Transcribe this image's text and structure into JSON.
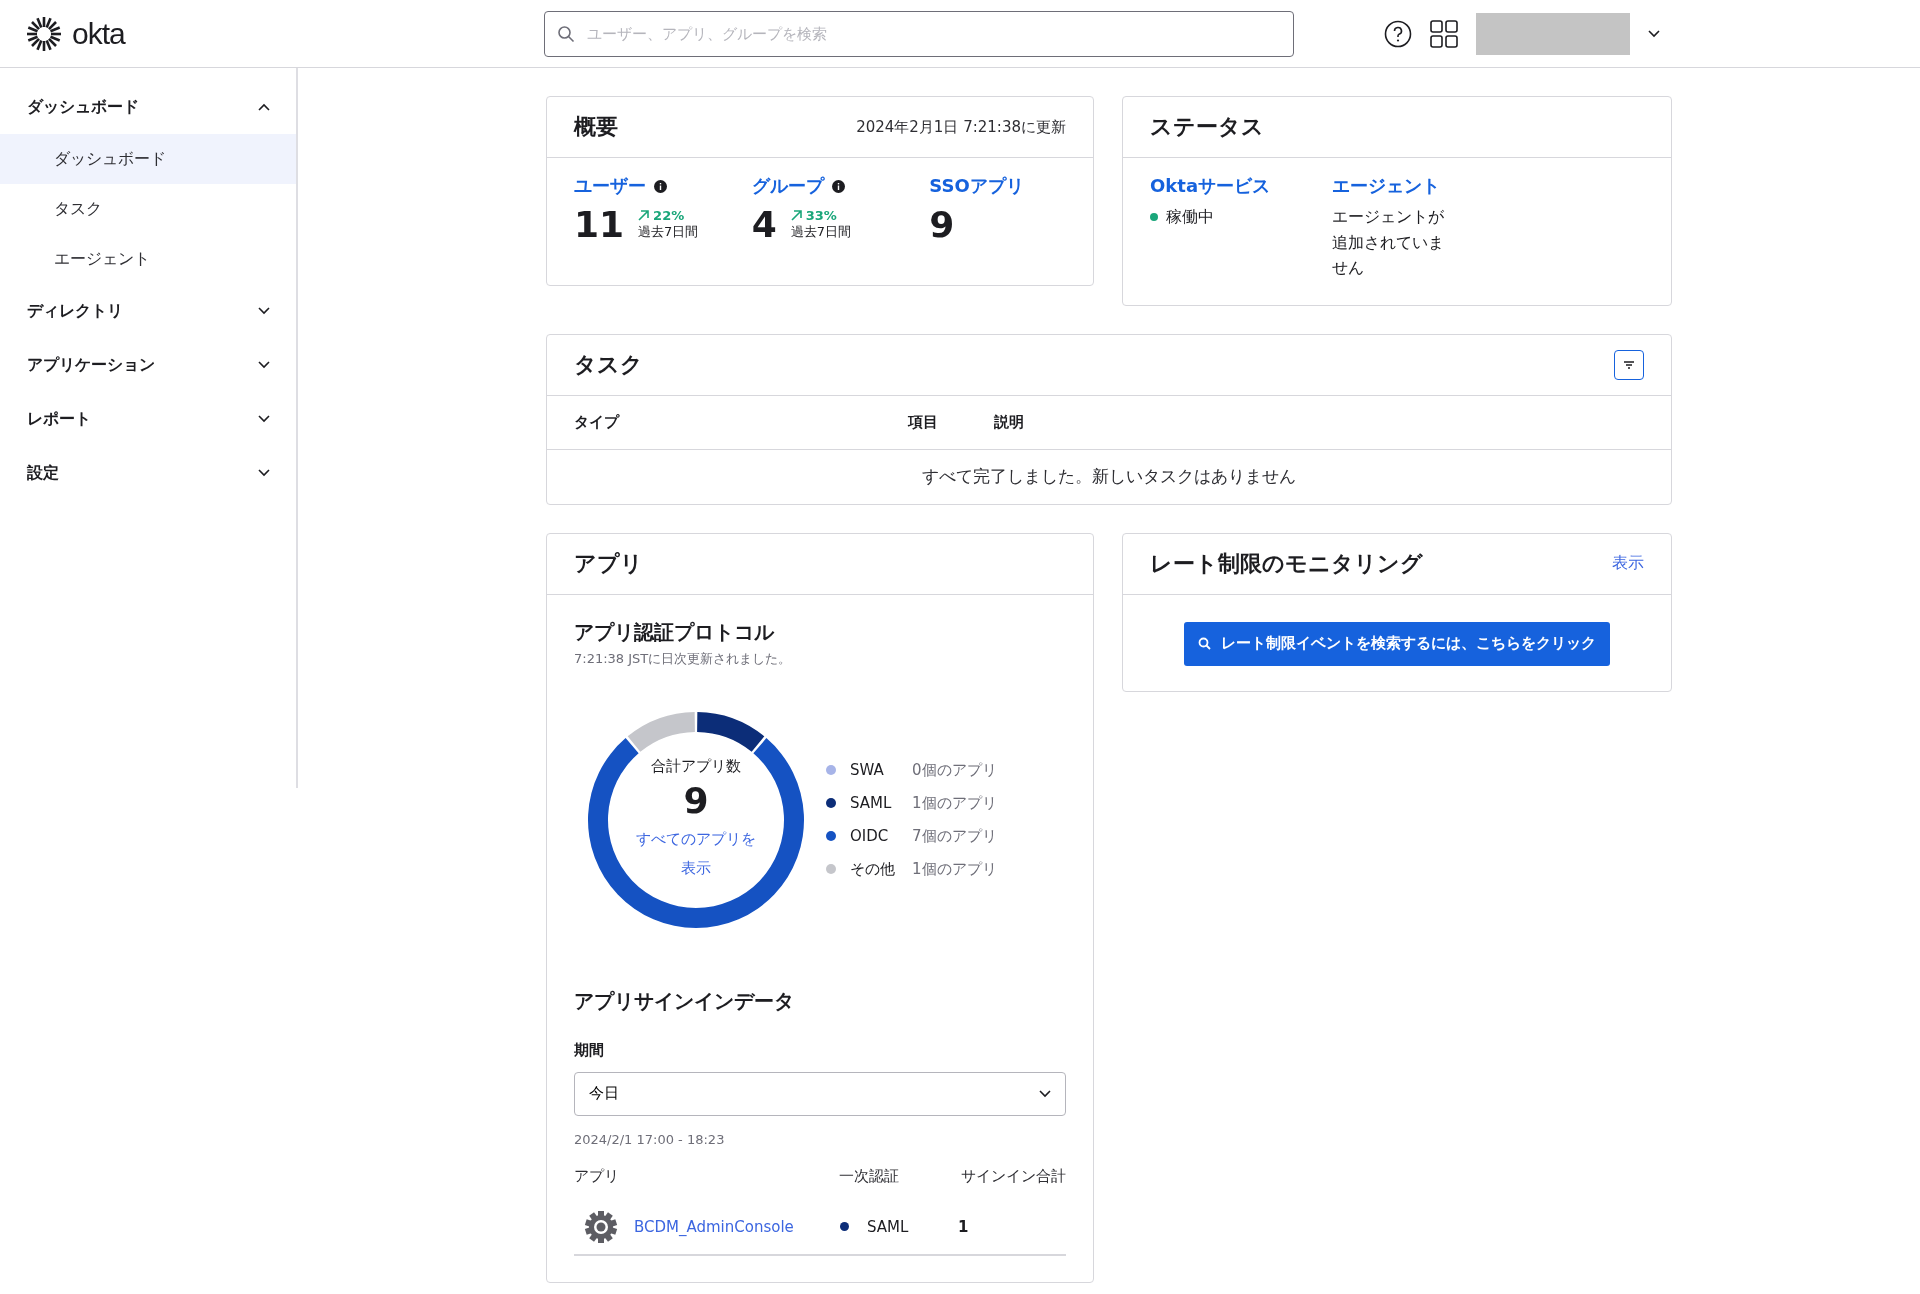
{
  "header": {
    "logo": "okta",
    "search": {
      "placeholder": "ユーザー、アプリ、グループを検索"
    }
  },
  "sidebar": {
    "items": [
      {
        "label": "ダッシュボード",
        "expanded": true,
        "children": [
          {
            "label": "ダッシュボード",
            "selected": true
          },
          {
            "label": "タスク",
            "selected": false
          },
          {
            "label": "エージェント",
            "selected": false
          }
        ]
      },
      {
        "label": "ディレクトリ",
        "expanded": false
      },
      {
        "label": "アプリケーション",
        "expanded": false
      },
      {
        "label": "レポート",
        "expanded": false
      },
      {
        "label": "設定",
        "expanded": false
      }
    ]
  },
  "overview": {
    "title": "概要",
    "updated": "2024年2月1日 7:21:38に更新",
    "stats": [
      {
        "label": "ユーザー",
        "info": true,
        "value": "11",
        "change": "22%",
        "period": "過去7日間"
      },
      {
        "label": "グループ",
        "info": true,
        "value": "4",
        "change": "33%",
        "period": "過去7日間"
      },
      {
        "label": "SSOアプリ",
        "info": false,
        "value": "9"
      }
    ]
  },
  "status": {
    "title": "ステータス",
    "columns": [
      {
        "label": "Oktaサービス",
        "kind": "dot",
        "text": "稼働中",
        "color": "#1aa67a"
      },
      {
        "label": "エージェント",
        "kind": "text",
        "text": "エージェントが追加されていません"
      }
    ]
  },
  "tasks": {
    "title": "タスク",
    "columns": [
      "タイプ",
      "項目",
      "説明"
    ],
    "empty": "すべて完了しました。新しいタスクはありません"
  },
  "apps": {
    "title": "アプリ",
    "protocol_title": "アプリ認証プロトコル",
    "protocol_note": "7:21:38 JSTに日次更新されました。",
    "center_label": "合計アプリ数",
    "center_value": "9",
    "center_link": "すべてのアプリを表示",
    "chart_data": {
      "type": "donut",
      "categories": [
        "SWA",
        "SAML",
        "OIDC",
        "その他"
      ],
      "values": [
        0,
        11.1,
        77.8,
        11.1
      ]
    },
    "legend": [
      {
        "count": "0個のアプリ",
        "color": "#a7b4e8"
      },
      {
        "count": "1個のアプリ",
        "color": "#0c2d78"
      },
      {
        "count": "7個のアプリ",
        "color": "#1552c2"
      },
      {
        "count": "1個のアプリ",
        "color": "#c5c6cb"
      }
    ],
    "signin_title": "アプリサインインデータ",
    "period_label": "期間",
    "period_value": "今日",
    "range": "2024/2/1 17:00 - 18:23",
    "table": {
      "columns": [
        "アプリ",
        "一次認証",
        "サインイン合計"
      ],
      "rows": [
        {
          "app": "BCDM_AdminConsole",
          "auth": "SAML",
          "color": "#0c2d78",
          "total": "1"
        }
      ]
    }
  },
  "rate": {
    "title": "レート制限のモニタリング",
    "link": "表示",
    "button": "レート制限イベントを検索するには、こちらをクリック"
  }
}
